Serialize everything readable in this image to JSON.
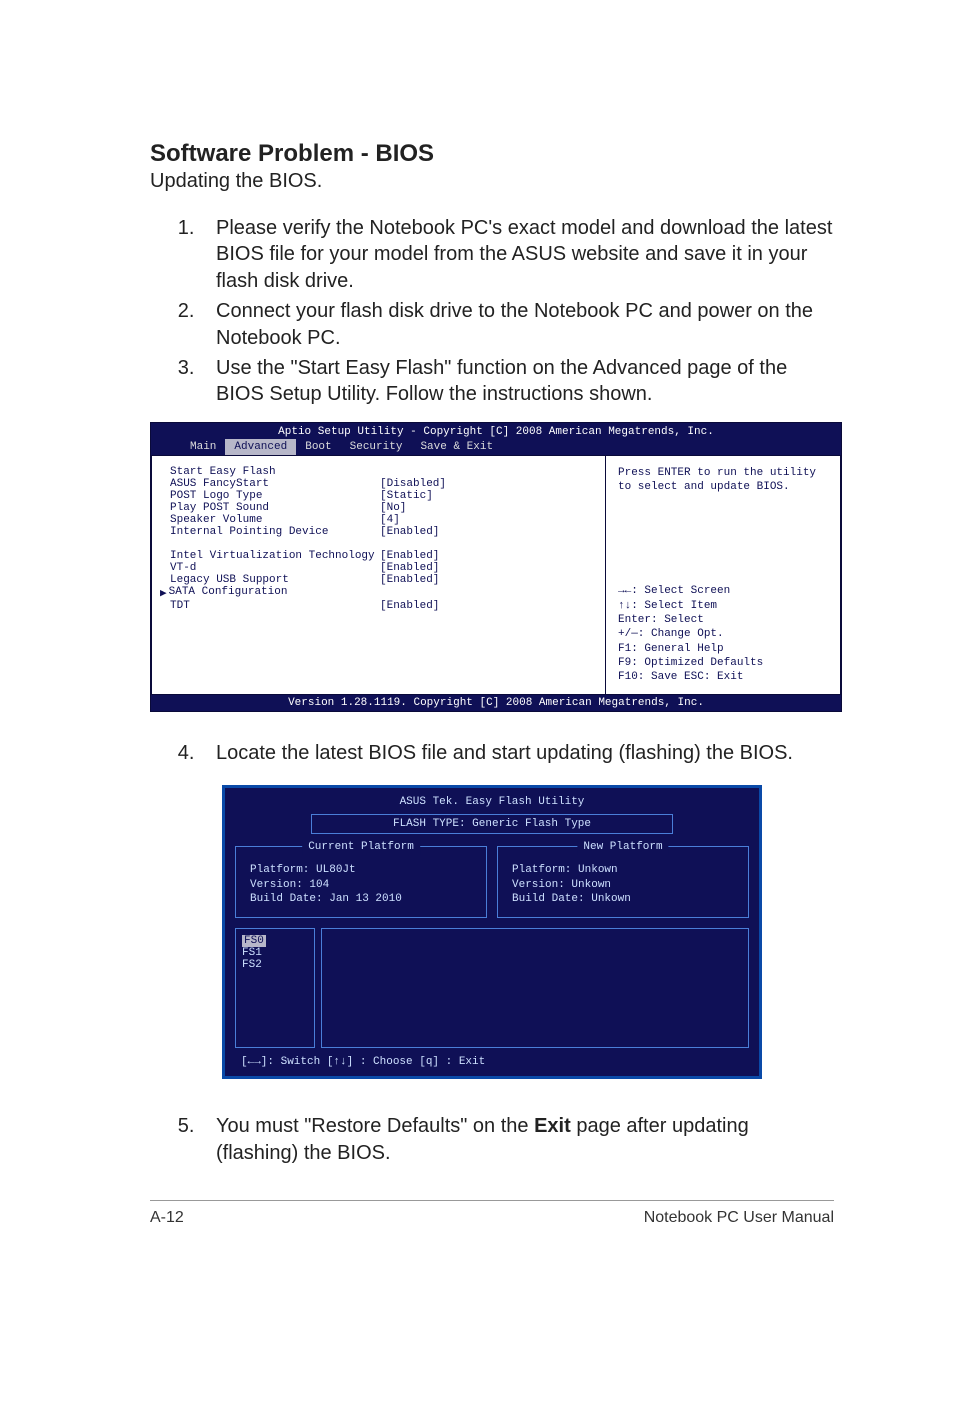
{
  "heading": "Software Problem - BIOS",
  "subtitle": "Updating the BIOS.",
  "steps": {
    "s1": "Please verify the Notebook PC's exact model and download the latest BIOS file for your model from the ASUS website and save it in your flash disk drive.",
    "s2": "Connect your flash disk drive to the Notebook PC and power on the Notebook PC.",
    "s3": "Use the \"Start Easy Flash\" function on the Advanced page of the BIOS Setup Utility. Follow the instructions shown.",
    "s4": "Locate the latest BIOS file and start updating (flashing) the BIOS.",
    "s5_a": "You must \"Restore Defaults\" on the ",
    "s5_bold": "Exit",
    "s5_b": " page after updating (flashing) the BIOS."
  },
  "bios1": {
    "title": "Aptio Setup Utility - Copyright [C] 2008 American Megatrends, Inc.",
    "menu": {
      "main": "Main",
      "advanced": "Advanced",
      "boot": "Boot",
      "security": "Security",
      "save": "Save & Exit"
    },
    "rows": {
      "r1": {
        "lbl": "Start Easy Flash",
        "val": ""
      },
      "r2": {
        "lbl": "ASUS FancyStart",
        "val": "[Disabled]"
      },
      "r3": {
        "lbl": "POST Logo Type",
        "val": "[Static]"
      },
      "r4": {
        "lbl": "Play POST Sound",
        "val": "[No]"
      },
      "r5": {
        "lbl": "Speaker Volume",
        "val": "[4]"
      },
      "r6": {
        "lbl": "Internal Pointing Device",
        "val": "[Enabled]"
      },
      "r7": {
        "lbl": "Intel Virtualization Technology",
        "val": "[Enabled]"
      },
      "r8": {
        "lbl": "VT-d",
        "val": "[Enabled]"
      },
      "r9": {
        "lbl": "Legacy USB Support",
        "val": "[Enabled]"
      },
      "r10": {
        "lbl": "SATA Configuration",
        "val": ""
      },
      "r11": {
        "lbl": "TDT",
        "val": "[Enabled]"
      }
    },
    "help": {
      "line1": "Press ENTER to run the utility",
      "line2": "to select and update BIOS.",
      "n1": "→←:  Select Screen",
      "n2": "↑↓:    Select Item",
      "n3": "Enter: Select",
      "n4": "+/—:  Change Opt.",
      "n5": "F1:    General Help",
      "n6": "F9:    Optimized Defaults",
      "n7": "F10:  Save   ESC: Exit"
    },
    "version": "Version 1.28.1119. Copyright [C] 2008 American Megatrends, Inc."
  },
  "bios2": {
    "title": "ASUS Tek. Easy Flash Utility",
    "flash_type": "FLASH TYPE: Generic Flash Type",
    "current": {
      "legend": "Current Platform",
      "l1": "Platform:   UL80Jt",
      "l2": "Version:    104",
      "l3": "Build Date: Jan 13 2010"
    },
    "new": {
      "legend": "New Platform",
      "l1": "Platform:   Unkown",
      "l2": "Version:    Unkown",
      "l3": "Build Date: Unkown"
    },
    "fs": {
      "f0": "FS0",
      "f1": "FS1",
      "f2": "FS2"
    },
    "keys": "[←→]: Switch   [↑↓] : Choose   [q] : Exit"
  },
  "footer": {
    "left": "A-12",
    "right": "Notebook PC User Manual"
  }
}
